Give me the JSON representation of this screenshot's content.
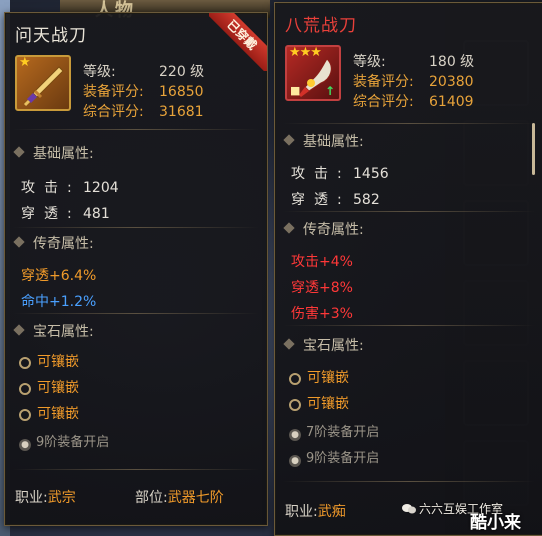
{
  "background": {
    "title_text": "人物"
  },
  "panel_left": {
    "name": "问天战刀",
    "ribbon": "已穿戴",
    "stars": "★",
    "level_label": "等级:",
    "level_value": "220 级",
    "equip_label": "装备评分:",
    "equip_value": "16850",
    "total_label": "综合评分:",
    "total_value": "31681",
    "basic_title": "基础属性:",
    "basic": [
      {
        "k": "攻击:",
        "v": "1204"
      },
      {
        "k": "穿透:",
        "v": "481"
      }
    ],
    "legend_title": "传奇属性:",
    "legend": [
      "穿透+6.4%",
      "命中+1.2%"
    ],
    "gem_title": "宝石属性:",
    "sockets": [
      "可镶嵌",
      "可镶嵌",
      "可镶嵌"
    ],
    "locked": [
      "9阶装备开启"
    ],
    "job_label": "职业:",
    "job_value": "武宗",
    "slot_label": "部位:",
    "slot_value": "武器七阶"
  },
  "panel_right": {
    "name": "八荒战刀",
    "stars": "★★★",
    "level_label": "等级:",
    "level_value": "180 级",
    "equip_label": "装备评分:",
    "equip_value": "20380",
    "total_label": "综合评分:",
    "total_value": "61409",
    "basic_title": "基础属性:",
    "basic": [
      {
        "k": "攻击:",
        "v": "1456"
      },
      {
        "k": "穿透:",
        "v": "582"
      }
    ],
    "legend_title": "传奇属性:",
    "legend": [
      "攻击+4%",
      "穿透+8%",
      "伤害+3%"
    ],
    "gem_title": "宝石属性:",
    "sockets": [
      "可镶嵌",
      "可镶嵌"
    ],
    "locked": [
      "7阶装备开启",
      "9阶装备开启"
    ],
    "job_label": "职业:",
    "job_value": "武痴"
  },
  "watermark": {
    "text1": "六六互娱工作室",
    "text2": "酷小来"
  },
  "colors": {
    "gold": "#e8a33a",
    "legend_orange": "#f09a2a",
    "legend_blue": "#4aa0ff",
    "legend_red": "#ff3838",
    "title_red": "#e8403a"
  }
}
